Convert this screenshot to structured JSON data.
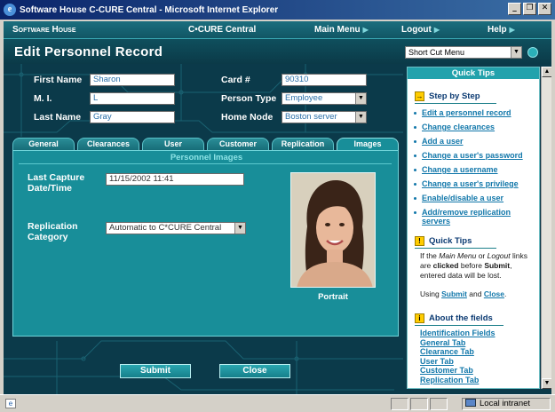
{
  "window": {
    "title": "Software House C-CURE Central - Microsoft Internet Explorer"
  },
  "nav": {
    "brand": "Software House",
    "center": "C•CURE Central",
    "main_menu": "Main Menu",
    "logout": "Logout",
    "help": "Help"
  },
  "header": {
    "title": "Edit Personnel Record",
    "shortcut_value": "Short Cut Menu"
  },
  "form": {
    "first_name_label": "First Name",
    "first_name": "Sharon",
    "mi_label": "M. I.",
    "mi": "L",
    "last_name_label": "Last Name",
    "last_name": "Gray",
    "card_label": "Card #",
    "card": "90310",
    "person_type_label": "Person Type",
    "person_type": "Employee",
    "home_node_label": "Home Node",
    "home_node": "Boston server"
  },
  "tabs": [
    "General",
    "Clearances",
    "User",
    "Customer",
    "Replication",
    "Images"
  ],
  "active_tab": "Images",
  "panel": {
    "title": "Personnel Images",
    "last_capture_label": "Last Capture Date/Time",
    "last_capture": "11/15/2002 11:41",
    "replication_label": "Replication Category",
    "replication": "Automatic to C*CURE Central",
    "portrait_caption": "Portrait"
  },
  "buttons": {
    "submit": "Submit",
    "close": "Close"
  },
  "sidebar": {
    "header": "Quick Tips",
    "step_title": "Step by Step",
    "steps": [
      "Edit a personnel record",
      "Change clearances",
      "Add a user",
      "Change a user's password",
      "Change a username",
      "Change a user's privilege",
      "Enable/disable a user",
      "Add/remove replication",
      "servers"
    ],
    "tips_title": "Quick Tips",
    "tips_text": {
      "p1": "If the ",
      "menu": "Main Menu",
      "p2": " or ",
      "logout": "Logout",
      "p3": " links are ",
      "clicked": "clicked",
      "p4": " before ",
      "submit": "Submit",
      "p5": ", entered data will be lost."
    },
    "using_text": {
      "p1": "Using ",
      "submit": "Submit",
      "p2": " and ",
      "close": "Close",
      "p3": "."
    },
    "fields_title": "About the fields",
    "field_links": [
      "Identification Fields",
      "General Tab",
      "Clearance Tab",
      "User Tab",
      "Customer Tab",
      "Replication Tab"
    ]
  },
  "status": {
    "zone": "Local intranet"
  },
  "colors": {
    "accent": "#188e99",
    "background": "#0b3a4a",
    "link": "#1177aa"
  }
}
